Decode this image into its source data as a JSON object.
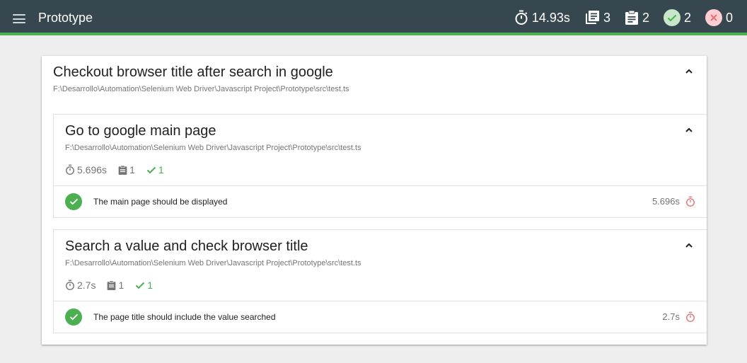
{
  "header": {
    "title": "Prototype",
    "duration": "14.93s",
    "suites": "3",
    "tests": "2",
    "passed": "2",
    "failed": "0"
  },
  "suite": {
    "title": "Checkout browser title after search in google",
    "path": "F:\\Desarrollo\\Automation\\Selenium Web Driver\\Javascript Project\\Prototype\\src\\test.ts",
    "tests": [
      {
        "title": "Go to google main page",
        "path": "F:\\Desarrollo\\Automation\\Selenium Web Driver\\Javascript Project\\Prototype\\src\\test.ts",
        "duration": "5.696s",
        "count": "1",
        "passed": "1",
        "assertion": "The main page should be displayed",
        "assertion_duration": "5.696s"
      },
      {
        "title": "Search a value and check browser title",
        "path": "F:\\Desarrollo\\Automation\\Selenium Web Driver\\Javascript Project\\Prototype\\src\\test.ts",
        "duration": "2.7s",
        "count": "1",
        "passed": "1",
        "assertion": "The page title should include the value searched",
        "assertion_duration": "2.7s"
      }
    ]
  },
  "colors": {
    "header_bg": "#37474f",
    "accent_green": "#4caf50",
    "fail_red": "#e57373"
  }
}
